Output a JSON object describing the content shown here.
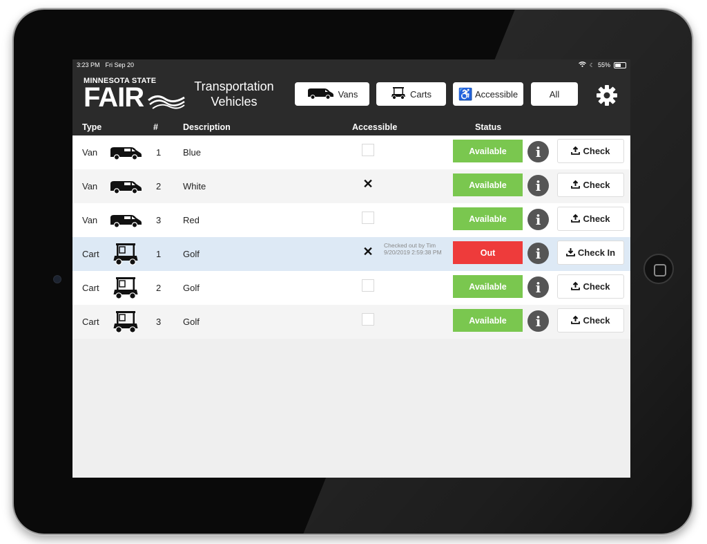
{
  "status_bar": {
    "time": "3:23 PM",
    "date": "Fri Sep 20",
    "battery": "55%"
  },
  "logo": {
    "line1": "MINNESOTA STATE",
    "line2": "FAIR"
  },
  "header": {
    "title": "Transportation Vehicles",
    "filters": [
      {
        "label": "Vans",
        "icon": "van-icon"
      },
      {
        "label": "Carts",
        "icon": "golf-cart-icon"
      },
      {
        "label": "Accessible",
        "icon": "wheelchair-icon"
      },
      {
        "label": "All",
        "icon": ""
      }
    ],
    "settings_icon": "gear-icon"
  },
  "table": {
    "columns": [
      "Type",
      "#",
      "Description",
      "Accessible",
      "Status"
    ],
    "rows": [
      {
        "type": "Van",
        "icon": "van-icon",
        "number": "1",
        "description": "Blue",
        "accessible": false,
        "note": "",
        "status": "Available",
        "action": "Check"
      },
      {
        "type": "Van",
        "icon": "van-icon",
        "number": "2",
        "description": "White",
        "accessible": true,
        "note": "",
        "status": "Available",
        "action": "Check"
      },
      {
        "type": "Van",
        "icon": "van-icon",
        "number": "3",
        "description": "Red",
        "accessible": false,
        "note": "",
        "status": "Available",
        "action": "Check"
      },
      {
        "type": "Cart",
        "icon": "golf-cart-icon",
        "number": "1",
        "description": "Golf",
        "accessible": true,
        "note": "Checked out by Tim\n9/20/2019 2:59:38 PM",
        "status": "Out",
        "action": "Check In"
      },
      {
        "type": "Cart",
        "icon": "golf-cart-icon",
        "number": "2",
        "description": "Golf",
        "accessible": false,
        "note": "",
        "status": "Available",
        "action": "Check"
      },
      {
        "type": "Cart",
        "icon": "golf-cart-icon",
        "number": "3",
        "description": "Golf",
        "accessible": false,
        "note": "",
        "status": "Available",
        "action": "Check"
      }
    ]
  },
  "colors": {
    "available": "#7ac74f",
    "out": "#ee3b3b",
    "header_bg": "#2b2b2b",
    "selected_row": "#dde9f5"
  }
}
